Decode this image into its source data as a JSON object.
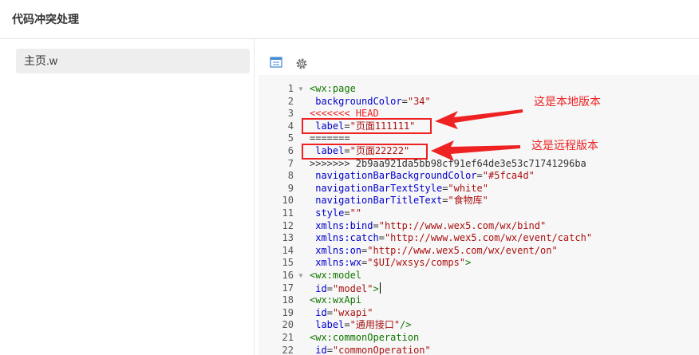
{
  "window": {
    "title": "代码冲突处理"
  },
  "files": [
    {
      "name": "主页.w"
    }
  ],
  "toolbar": {
    "view_icon": "layout-icon",
    "settings_icon": "gear-icon"
  },
  "colors": {
    "tag": "#117700",
    "attr": "#0000cc",
    "string": "#aa1111",
    "conflict": "#ee2222",
    "highlight": "#ee2222"
  },
  "editor": {
    "lines": [
      {
        "n": "1",
        "fold": true,
        "tokens": [
          [
            "tag",
            "<wx:page"
          ]
        ]
      },
      {
        "n": "2",
        "fold": false,
        "tokens": [
          [
            "plain",
            " "
          ],
          [
            "attr",
            "backgroundColor"
          ],
          [
            "plain",
            "="
          ],
          [
            "str",
            "\"34\""
          ]
        ]
      },
      {
        "n": "3",
        "fold": false,
        "tokens": [
          [
            "conflict",
            "<<<<<<< HEAD"
          ]
        ]
      },
      {
        "n": "4",
        "fold": false,
        "tokens": [
          [
            "plain",
            " "
          ],
          [
            "attr",
            "label"
          ],
          [
            "plain",
            "="
          ],
          [
            "str",
            "\"页面111111\""
          ]
        ]
      },
      {
        "n": "5",
        "fold": false,
        "tokens": [
          [
            "plain",
            "======="
          ]
        ]
      },
      {
        "n": "6",
        "fold": false,
        "tokens": [
          [
            "plain",
            " "
          ],
          [
            "attr",
            "label"
          ],
          [
            "plain",
            "="
          ],
          [
            "str",
            "\"页面22222\""
          ]
        ]
      },
      {
        "n": "7",
        "fold": false,
        "tokens": [
          [
            "plain",
            ">>>>>>> 2b9aa921da5bb98cf91ef64de3e53c71741296ba"
          ]
        ]
      },
      {
        "n": "8",
        "fold": false,
        "tokens": [
          [
            "plain",
            " "
          ],
          [
            "attr",
            "navigationBarBackgroundColor"
          ],
          [
            "plain",
            "="
          ],
          [
            "str",
            "\"#5fca4d\""
          ]
        ]
      },
      {
        "n": "9",
        "fold": false,
        "tokens": [
          [
            "plain",
            " "
          ],
          [
            "attr",
            "navigationBarTextStyle"
          ],
          [
            "plain",
            "="
          ],
          [
            "str",
            "\"white\""
          ]
        ]
      },
      {
        "n": "10",
        "fold": false,
        "tokens": [
          [
            "plain",
            " "
          ],
          [
            "attr",
            "navigationBarTitleText"
          ],
          [
            "plain",
            "="
          ],
          [
            "str",
            "\"食物库\""
          ]
        ]
      },
      {
        "n": "11",
        "fold": false,
        "tokens": [
          [
            "plain",
            " "
          ],
          [
            "attr",
            "style"
          ],
          [
            "plain",
            "="
          ],
          [
            "str",
            "\"\""
          ]
        ]
      },
      {
        "n": "12",
        "fold": false,
        "tokens": [
          [
            "plain",
            " "
          ],
          [
            "attr",
            "xmlns:bind"
          ],
          [
            "plain",
            "="
          ],
          [
            "str",
            "\"http://www.wex5.com/wx/bind\""
          ]
        ]
      },
      {
        "n": "13",
        "fold": false,
        "tokens": [
          [
            "plain",
            " "
          ],
          [
            "attr",
            "xmlns:catch"
          ],
          [
            "plain",
            "="
          ],
          [
            "str",
            "\"http://www.wex5.com/wx/event/catch\""
          ]
        ]
      },
      {
        "n": "14",
        "fold": false,
        "tokens": [
          [
            "plain",
            " "
          ],
          [
            "attr",
            "xmlns:on"
          ],
          [
            "plain",
            "="
          ],
          [
            "str",
            "\"http://www.wex5.com/wx/event/on\""
          ]
        ]
      },
      {
        "n": "15",
        "fold": false,
        "tokens": [
          [
            "plain",
            " "
          ],
          [
            "attr",
            "xmlns:wx"
          ],
          [
            "plain",
            "="
          ],
          [
            "str",
            "\"$UI/wxsys/comps\""
          ],
          [
            "tag",
            ">"
          ]
        ]
      },
      {
        "n": "16",
        "fold": true,
        "tokens": [
          [
            "tag",
            "<wx:model"
          ]
        ]
      },
      {
        "n": "17",
        "fold": false,
        "tokens": [
          [
            "plain",
            " "
          ],
          [
            "attr",
            "id"
          ],
          [
            "plain",
            "="
          ],
          [
            "str",
            "\"model\""
          ],
          [
            "tag",
            ">"
          ],
          [
            "cursor",
            ""
          ]
        ]
      },
      {
        "n": "18",
        "fold": false,
        "tokens": [
          [
            "tag",
            "<wx:wxApi"
          ]
        ]
      },
      {
        "n": "19",
        "fold": false,
        "tokens": [
          [
            "plain",
            " "
          ],
          [
            "attr",
            "id"
          ],
          [
            "plain",
            "="
          ],
          [
            "str",
            "\"wxapi\""
          ]
        ]
      },
      {
        "n": "20",
        "fold": false,
        "tokens": [
          [
            "plain",
            " "
          ],
          [
            "attr",
            "label"
          ],
          [
            "plain",
            "="
          ],
          [
            "str",
            "\"通用接口\""
          ],
          [
            "tag",
            "/>"
          ]
        ]
      },
      {
        "n": "21",
        "fold": false,
        "tokens": [
          [
            "tag",
            "<wx:commonOperation"
          ]
        ]
      },
      {
        "n": "22",
        "fold": false,
        "tokens": [
          [
            "plain",
            " "
          ],
          [
            "attr",
            "id"
          ],
          [
            "plain",
            "="
          ],
          [
            "str",
            "\"commonOperation\""
          ]
        ]
      }
    ]
  },
  "annotations": {
    "local": "这是本地版本",
    "remote": "这是远程版本"
  }
}
